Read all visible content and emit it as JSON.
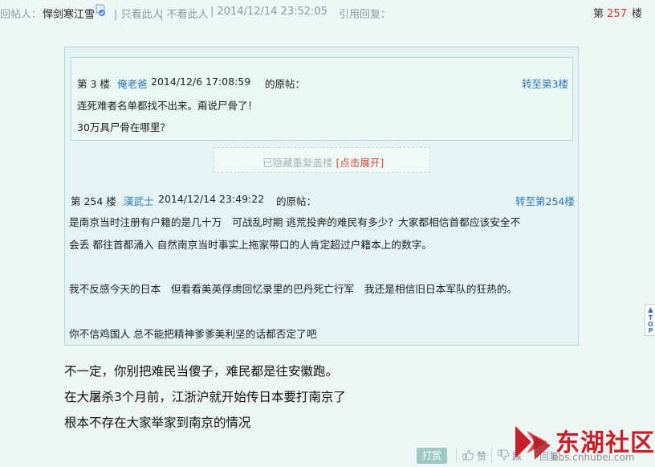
{
  "header": {
    "reply_label": "回帖人：",
    "author": "悍剑寒江雪",
    "only_this": "| 只看此人",
    "hide_this": "| 不看此人",
    "timestamp": "| 2014/12/14 23:52:05",
    "quote_reply": "引用回复：",
    "floor_prefix": "第",
    "floor_number": "257",
    "floor_suffix": "楼"
  },
  "inner_quote": {
    "floor_prefix": "第 3 楼",
    "author": "俺老爸",
    "time": "2014/12/6 17:08:59",
    "suffix": "的原帖：",
    "jump": "转至第3楼",
    "lines": [
      "连死难者名单都找不出来。甭说尸骨了！",
      "30万具尸骨在哪里？"
    ]
  },
  "hidden_notice": {
    "text": "已隐藏重复盖楼",
    "expand": "[点击展开]"
  },
  "outer_quote": {
    "floor_prefix": "第 254 楼",
    "author": "漢武士",
    "time": "2014/12/14 23:49:22",
    "suffix": "的原帖：",
    "jump": "转至第254楼",
    "lines": [
      "是南京当时注册有户籍的是几十万　可战乱时期 逃荒投奔的难民有多少？大家都相信首都应该安全不",
      "会丢  都往首都涌入  自然南京当时事实上拖家带口的人肯定超过户籍本上的数字。",
      "我不反感今天的日本　但看看美英俘虏回忆录里的巴丹死亡行军　我还是相信旧日本军队的狂热的。",
      "你不信鸡国人 总不能把精神爹爹美利坚的话都否定了吧"
    ]
  },
  "body": {
    "lines": [
      "不一定，你别把难民当傻子，难民都是往安徽跑。",
      "在大屠杀3个月前，江浙沪就开始传日本要打南京了",
      "根本不存在大家举家到南京的情况"
    ]
  },
  "actions": {
    "reward": "打赏",
    "like": "赞",
    "dislike": "踩",
    "reply": "回复"
  },
  "watermark": {
    "title": "东湖社区",
    "site": "bbs.cnhubei.com"
  },
  "top_button": "TOP"
}
